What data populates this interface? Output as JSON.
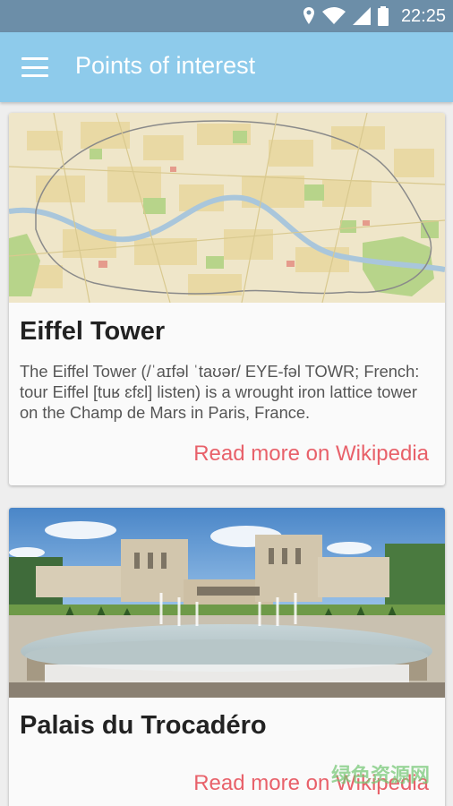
{
  "status_bar": {
    "time": "22:25",
    "icons": [
      "location-icon",
      "wifi-icon",
      "signal-icon",
      "battery-icon"
    ]
  },
  "app_bar": {
    "title": "Points of interest",
    "menu_icon": "hamburger-menu-icon"
  },
  "cards": [
    {
      "image": "paris-map",
      "title": "Eiffel Tower",
      "body": "The Eiffel Tower (/ˈaɪfəl ˈtaʊər/ EYE-fəl TOWR; French: tour Eiffel [tuʁ ɛfɛl]  listen) is a wrought iron lattice tower on the Champ de Mars in Paris, France.",
      "link": "Read more on Wikipedia"
    },
    {
      "image": "trocadero-fountain-photo",
      "title": "Palais du Trocadéro",
      "link": "Read more on Wikipedia"
    }
  ],
  "watermark": "绿色资源网",
  "colors": {
    "status_bar": "#6c8ea8",
    "app_bar": "#8ecbeb",
    "link": "#e8616a",
    "background": "#eeeeee"
  }
}
